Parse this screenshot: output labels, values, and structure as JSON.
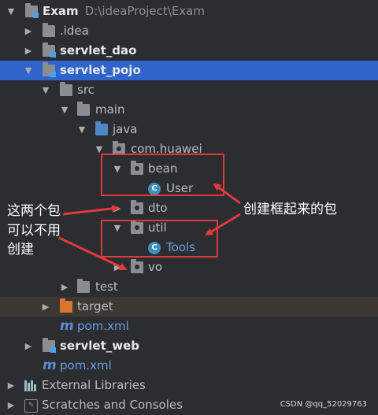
{
  "tree": {
    "root": {
      "name": "Exam",
      "path": "D:\\ideaProject\\Exam"
    },
    "idea": ".idea",
    "servlet_dao": "servlet_dao",
    "servlet_pojo": "servlet_pojo",
    "src": "src",
    "main": "main",
    "java": "java",
    "com_huawei": "com.huawei",
    "bean": "bean",
    "user": "User",
    "dto": "dto",
    "util": "util",
    "tools": "Tools",
    "vo": "vo",
    "test": "test",
    "target": "target",
    "pom_inner": "pom.xml",
    "servlet_web": "servlet_web",
    "pom_outer": "pom.xml",
    "external_libraries": "External Libraries",
    "scratches": "Scratches and Consoles"
  },
  "annotations": {
    "left_line1": "这两个包",
    "left_line2": "可以不用",
    "left_line3": "创建",
    "right": "创建框起来的包"
  },
  "class_icon_letter": "C",
  "watermark": "CSDN @qq_52029763",
  "colors": {
    "background": "#2b2d30",
    "selection": "#2f65ca",
    "annotation_red": "#e03a3a"
  }
}
